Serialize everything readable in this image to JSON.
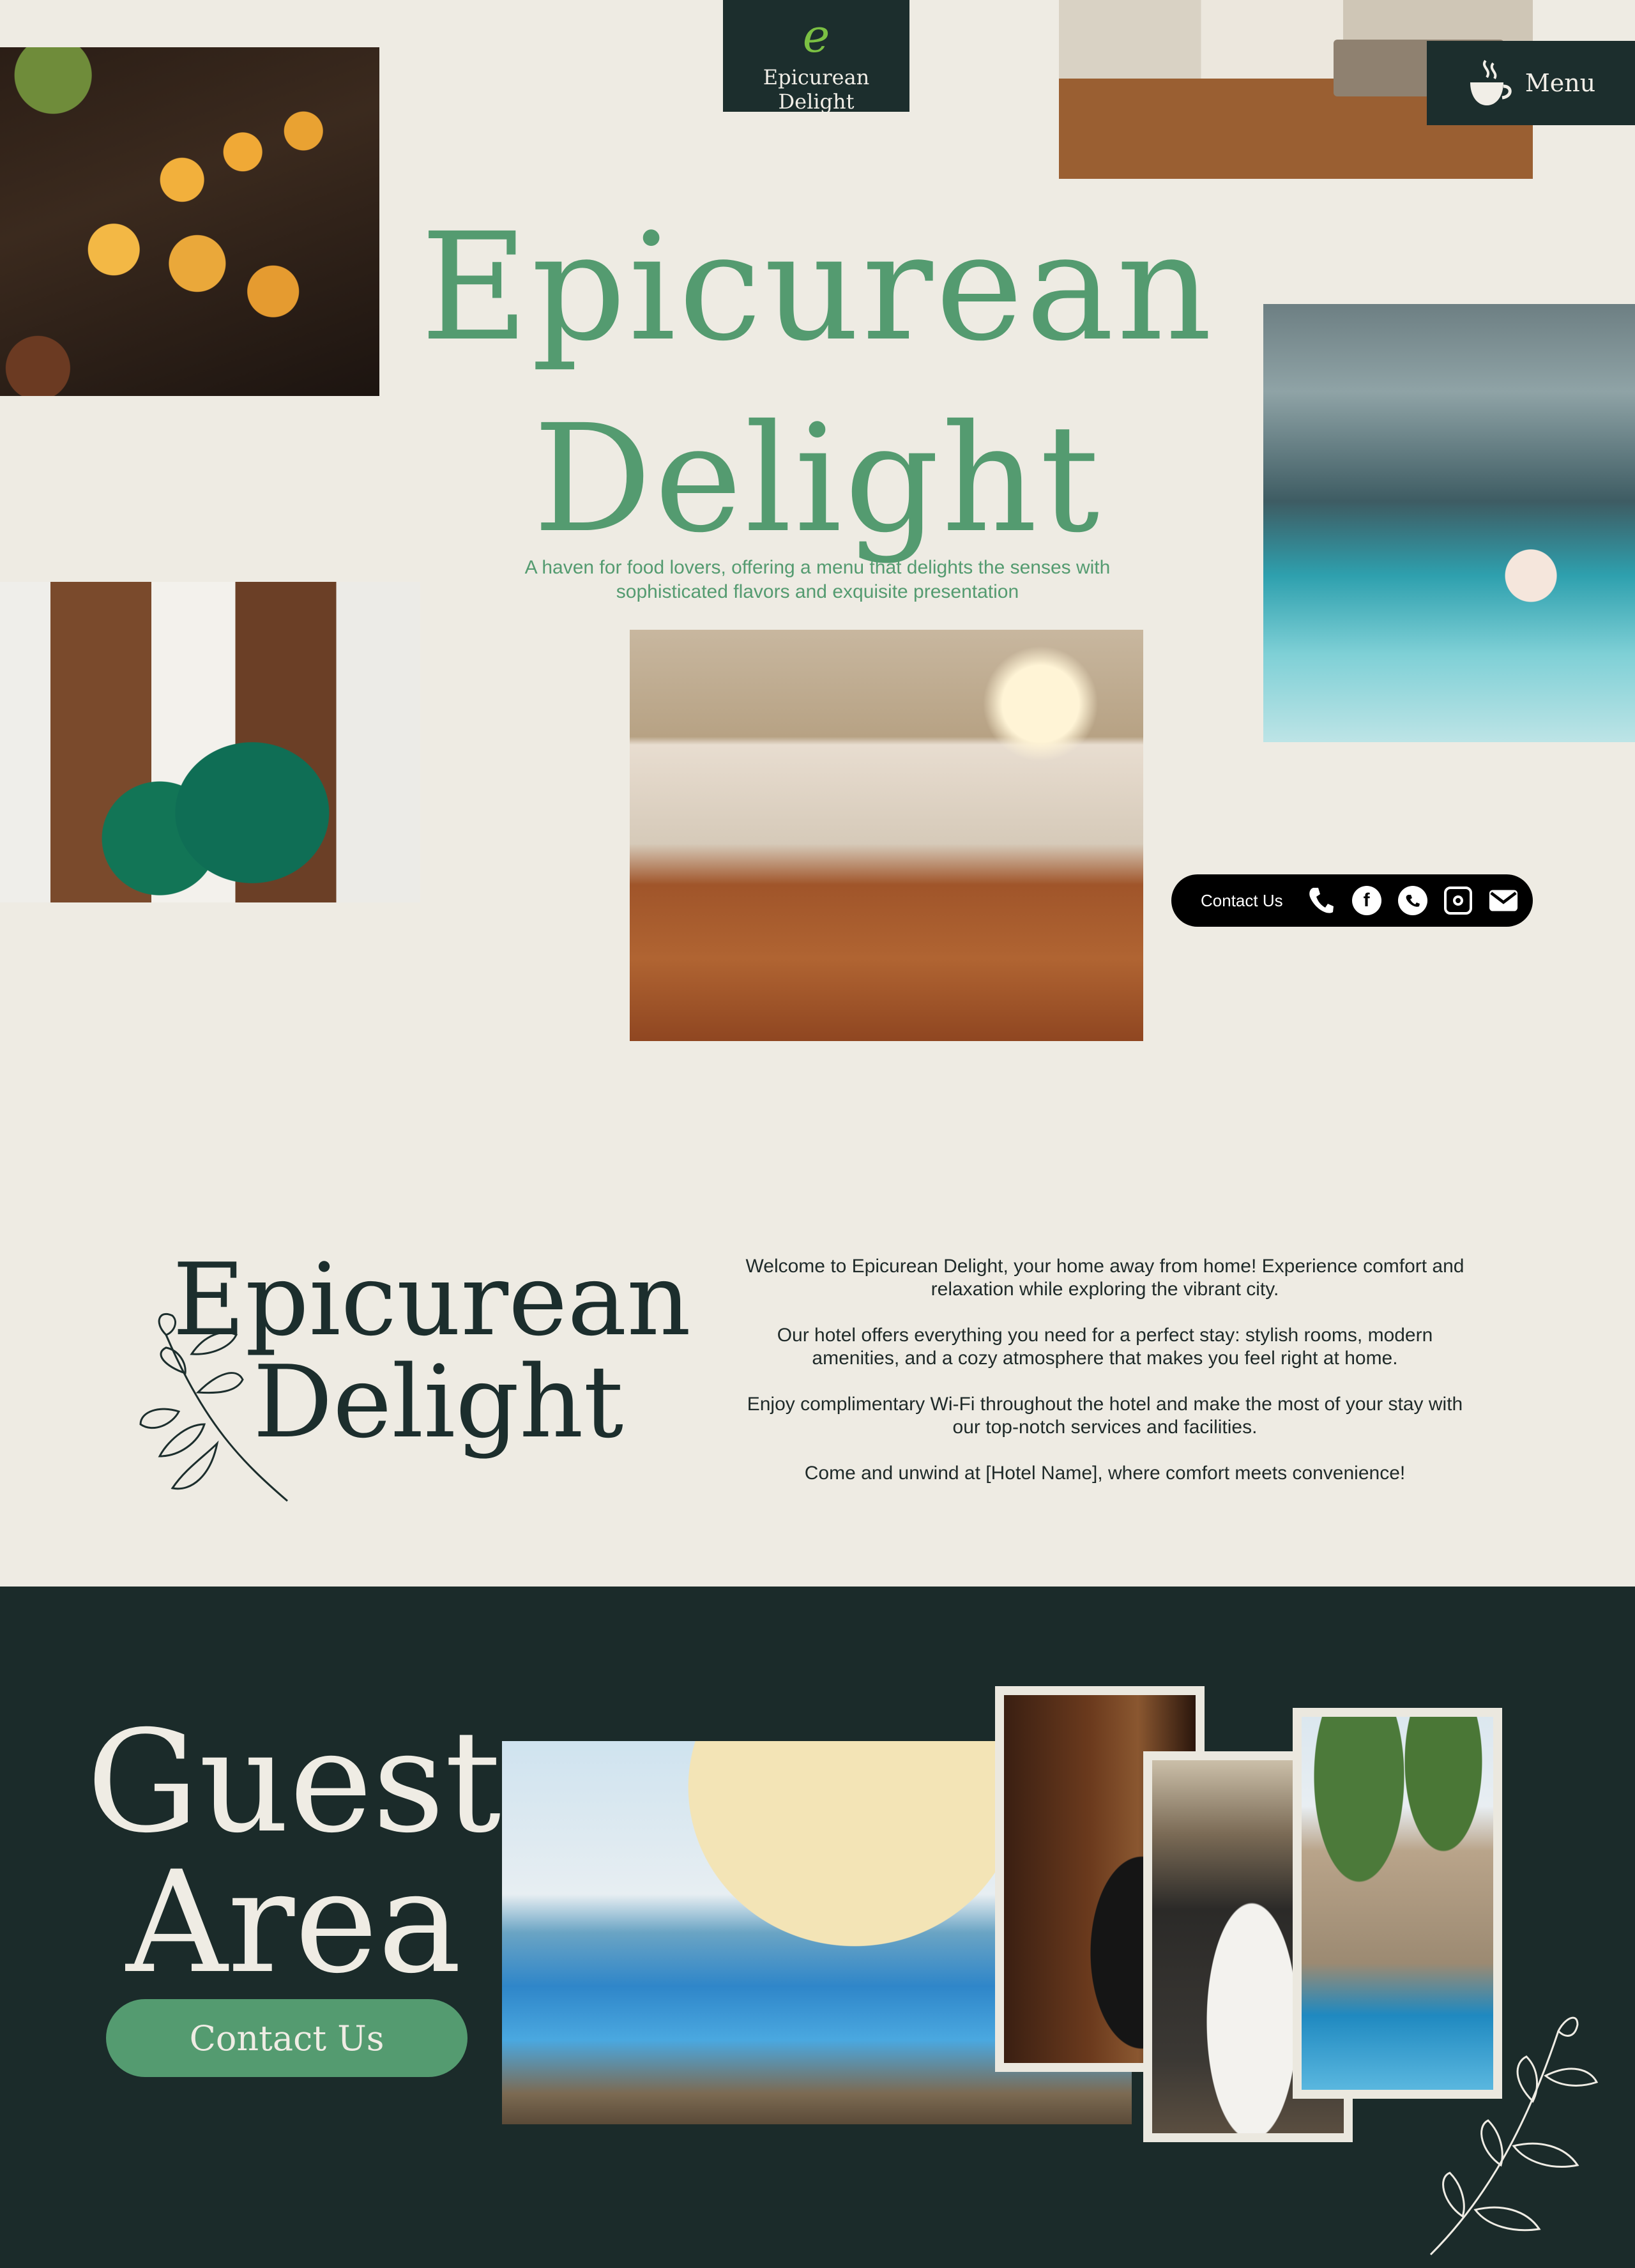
{
  "brand": {
    "logo_letter": "e",
    "name": "Epicurean Delight"
  },
  "header": {
    "menu_label": "Menu",
    "menu_icon": "coffee-cup-icon"
  },
  "hero": {
    "title_line1": "Epicurean",
    "title_line2": "Delight",
    "subtitle": "A haven for food lovers, offering a menu that delights the senses with sophisticated flavors and exquisite presentation"
  },
  "contact_bar": {
    "label": "Contact Us",
    "icons": [
      "phone-icon",
      "facebook-icon",
      "whatsapp-icon",
      "instagram-icon",
      "mail-icon"
    ]
  },
  "about": {
    "title_line1": "Epicurean",
    "title_line2": "Delight",
    "paragraphs": [
      "Welcome to Epicurean Delight, your home away from home! Experience comfort and relaxation while exploring the vibrant city.",
      "Our hotel offers everything you need for a perfect stay: stylish rooms, modern amenities, and a cozy atmosphere that makes you feel right at home.",
      "Enjoy complimentary Wi-Fi throughout the hotel and make the most of your stay with our top-notch services and facilities.",
      "Come and unwind at [Hotel Name], where comfort meets convenience!"
    ]
  },
  "guest": {
    "title_line1": "Guest",
    "title_line2": "Area",
    "button_label": "Contact Us"
  },
  "colors": {
    "cream": "#eeebe3",
    "dark_green": "#1c2e2d",
    "accent_green": "#549b70"
  }
}
